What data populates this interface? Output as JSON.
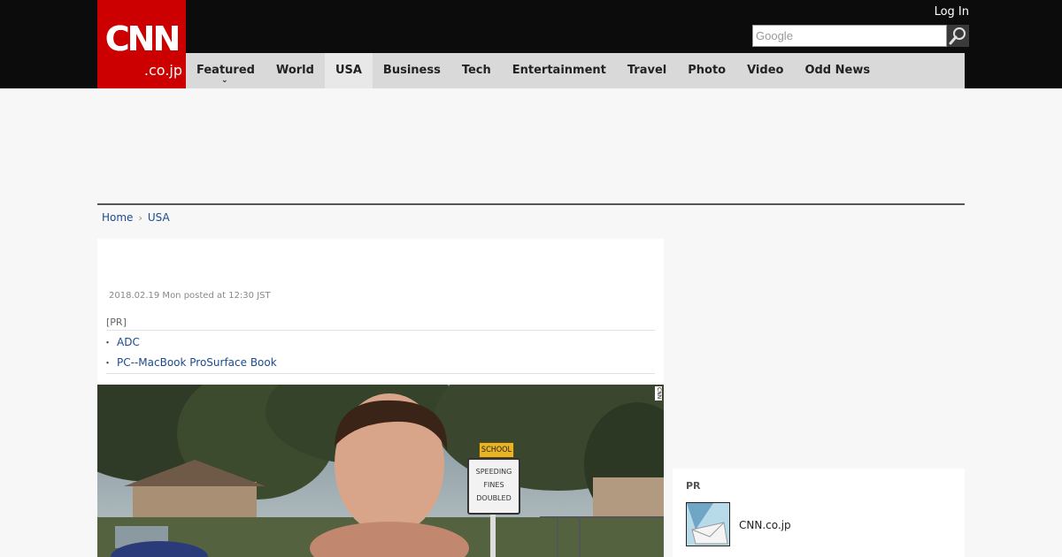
{
  "header": {
    "logo": {
      "main": "CNN",
      "sub": ".co.jp"
    },
    "login_label": "Log In",
    "search": {
      "placeholder": "Google"
    },
    "nav": [
      {
        "label": "Featured",
        "has_dropdown": true
      },
      {
        "label": "World"
      },
      {
        "label": "USA",
        "active": true
      },
      {
        "label": "Business"
      },
      {
        "label": "Tech"
      },
      {
        "label": "Entertainment"
      },
      {
        "label": "Travel"
      },
      {
        "label": "Photo"
      },
      {
        "label": "Video"
      },
      {
        "label": "Odd News"
      }
    ]
  },
  "breadcrumb": {
    "home": "Home",
    "current": "USA"
  },
  "article": {
    "dateline": "2018.02.19 Mon posted at 12:30 JST",
    "pr_label": "[PR]",
    "pr_links": [
      "ADC",
      "PC--MacBook ProSurface Book"
    ],
    "photo": {
      "watermark": "CNN",
      "sign_school": "SCHOOL",
      "sign_speeding": [
        "SPEEDING",
        "FINES",
        "DOUBLED"
      ]
    }
  },
  "sidebar": {
    "pr_title": "PR",
    "pr_item_label": "CNN.co.jp"
  },
  "colors": {
    "brand_red": "#cc0000",
    "topbar": "#0c0c0c",
    "nav_bg": "#d9d9d9",
    "link": "#1a4b8c"
  }
}
